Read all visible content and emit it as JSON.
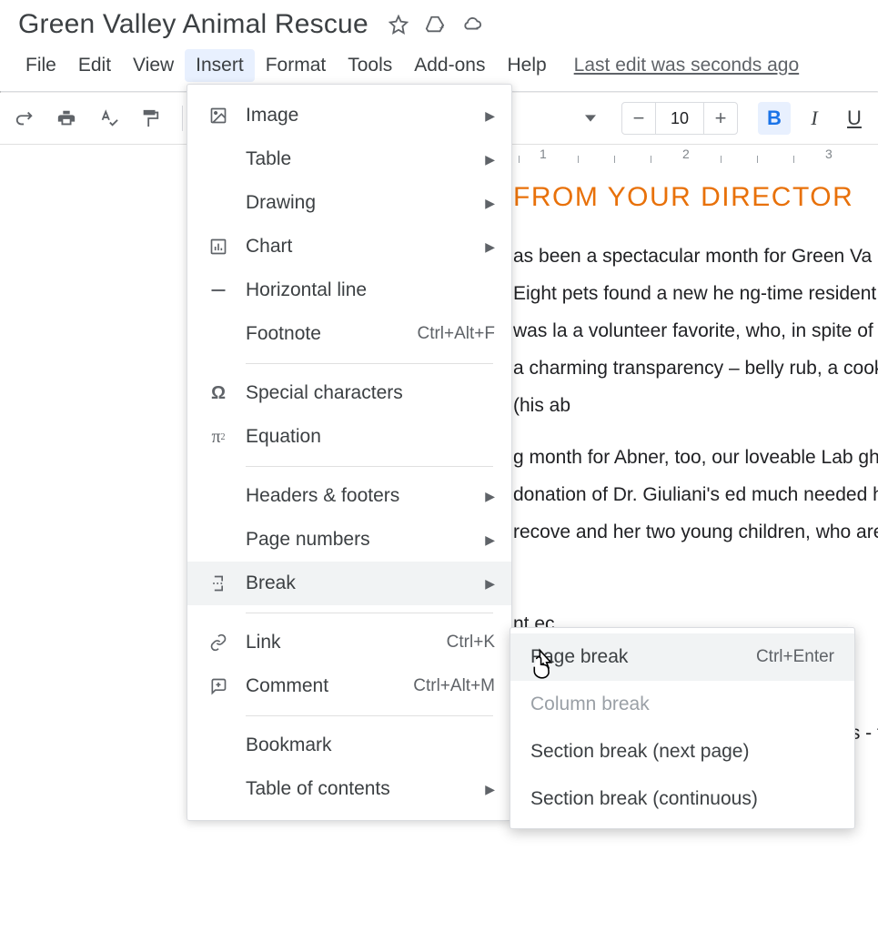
{
  "doc_title": "Green Valley Animal Rescue",
  "menubar": {
    "file": "File",
    "edit": "Edit",
    "view": "View",
    "insert": "Insert",
    "format": "Format",
    "tools": "Tools",
    "addons": "Add-ons",
    "help": "Help",
    "last_edit": "Last edit was seconds ago"
  },
  "toolbar": {
    "font_size": "10",
    "bold": "B",
    "italic": "I",
    "underline": "U",
    "minus": "−",
    "plus": "+"
  },
  "ruler": {
    "n1": "1",
    "n2": "2",
    "n3": "3"
  },
  "doc": {
    "heading": "FROM YOUR DIRECTOR",
    "p1": "as been a spectacular month for Green Va nals in our care! Eight pets found a new he ng-time resident of the kennel who was la a volunteer favorite, who, in spite of his sp of humor and a charming transparency – belly rub, a cookie, or an ice cube (his ab",
    "p2": "g month for Abner, too, our loveable Lab gh the generous donation of Dr. Giuliani's ed much needed hip surgery. He's recove and her two young children, who are tea",
    "p3": "nt ec",
    "p4": "sib hey find a home. To all our volunteers - fr ose who help with fundraising and speci"
  },
  "insert_menu": {
    "image": "Image",
    "table": "Table",
    "drawing": "Drawing",
    "chart": "Chart",
    "hline": "Horizontal line",
    "footnote": "Footnote",
    "footnote_sc": "Ctrl+Alt+F",
    "special": "Special characters",
    "equation": "Equation",
    "headers": "Headers & footers",
    "page_numbers": "Page numbers",
    "break": "Break",
    "link": "Link",
    "link_sc": "Ctrl+K",
    "comment": "Comment",
    "comment_sc": "Ctrl+Alt+M",
    "bookmark": "Bookmark",
    "toc": "Table of contents"
  },
  "break_submenu": {
    "page": "Page break",
    "page_sc": "Ctrl+Enter",
    "column": "Column break",
    "section_next": "Section break (next page)",
    "section_cont": "Section break (continuous)"
  }
}
